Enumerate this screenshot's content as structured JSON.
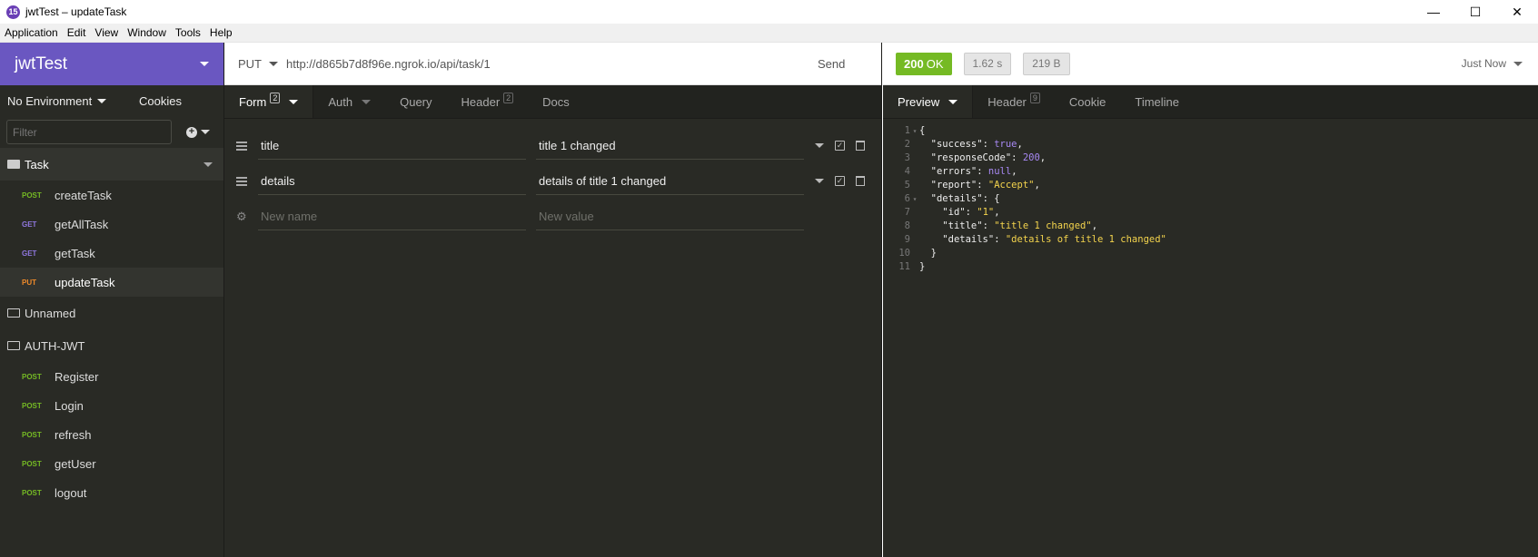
{
  "window": {
    "app_icon": "15",
    "title": "jwtTest – updateTask",
    "controls": [
      "—",
      "☐",
      "✕"
    ]
  },
  "menu": [
    "Application",
    "Edit",
    "View",
    "Window",
    "Tools",
    "Help"
  ],
  "sidebar": {
    "workspace": "jwtTest",
    "environment": "No Environment",
    "cookies": "Cookies",
    "filter_placeholder": "Filter",
    "folders": [
      {
        "name": "Task",
        "open": true,
        "requests": [
          {
            "method": "POST",
            "name": "createTask"
          },
          {
            "method": "GET",
            "name": "getAllTask"
          },
          {
            "method": "GET",
            "name": "getTask"
          },
          {
            "method": "PUT",
            "name": "updateTask",
            "active": true
          }
        ]
      },
      {
        "name": "Unnamed",
        "open": false,
        "requests": []
      },
      {
        "name": "AUTH-JWT",
        "open": true,
        "requests": [
          {
            "method": "POST",
            "name": "Register"
          },
          {
            "method": "POST",
            "name": "Login"
          },
          {
            "method": "POST",
            "name": "refresh"
          },
          {
            "method": "POST",
            "name": "getUser"
          },
          {
            "method": "POST",
            "name": "logout"
          }
        ]
      }
    ]
  },
  "request": {
    "method": "PUT",
    "url": "http://d865b7d8f96e.ngrok.io/api/task/1",
    "send_label": "Send",
    "tabs": [
      {
        "label": "Form",
        "badge": "2"
      },
      {
        "label": "Auth",
        "badge": ""
      },
      {
        "label": "Query",
        "badge": ""
      },
      {
        "label": "Header",
        "badge": "2"
      },
      {
        "label": "Docs",
        "badge": ""
      }
    ],
    "form_rows": [
      {
        "name": "title",
        "value": "title 1 changed"
      },
      {
        "name": "details",
        "value": "details of title 1 changed"
      }
    ],
    "new_name_placeholder": "New name",
    "new_value_placeholder": "New value"
  },
  "response": {
    "status_code": "200",
    "status_text": "OK",
    "time": "1.62 s",
    "size": "219 B",
    "history": "Just Now",
    "tabs": [
      {
        "label": "Preview",
        "badge": ""
      },
      {
        "label": "Header",
        "badge": "9"
      },
      {
        "label": "Cookie",
        "badge": ""
      },
      {
        "label": "Timeline",
        "badge": ""
      }
    ],
    "body_lines": [
      "{",
      "  \"success\": true,",
      "  \"responseCode\": 200,",
      "  \"errors\": null,",
      "  \"report\": \"Accept\",",
      "  \"details\": {",
      "    \"id\": \"1\",",
      "    \"title\": \"title 1 changed\",",
      "    \"details\": \"details of title 1 changed\"",
      "  }",
      "}"
    ]
  },
  "colors": {
    "sidebar_header": "#6a57c1",
    "dark_bg": "#292a25",
    "status_ok": "#75ba24",
    "method_post": "#75ba24",
    "method_get": "#8f77de",
    "method_put": "#ee8a2a",
    "json_string": "#f4d44d",
    "json_literal": "#a788f3"
  }
}
